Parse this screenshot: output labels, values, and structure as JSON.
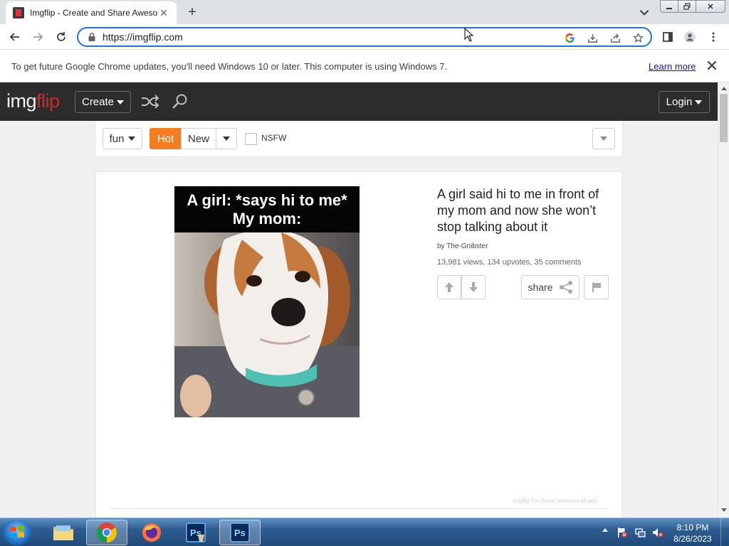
{
  "browser": {
    "tab_title": "Imgflip - Create and Share Awesome Images",
    "tab_close": "✕",
    "new_tab": "+",
    "url": "https://imgflip.com"
  },
  "infobar": {
    "message": "To get future Google Chrome updates, you'll need Windows 10 or later. This computer is using Windows 7.",
    "link": "Learn more"
  },
  "site": {
    "logo_part1": "img",
    "logo_part2": "flip",
    "create_label": "Create",
    "login_label": "Login",
    "logo_red": "#cc2a2a",
    "header_bg": "#2c2c2c"
  },
  "filters": {
    "category": "fun",
    "hot_label": "Hot",
    "new_label": "New",
    "nsfw_label": "NSFW",
    "hot_color": "#f57c1f"
  },
  "post": {
    "meme_caption_line1": "A girl: *says hi to me*",
    "meme_caption_line2": "My mom:",
    "title": "A girl said hi to me in front of my mom and now she won’t stop talking about it",
    "by_prefix": "by ",
    "author": "The-Gnibster",
    "stats": "13,981 views, 134 upvotes, 35 comments",
    "share_label": "share",
    "pro_note": "Imgflip Pro Basic removes all ads"
  },
  "taskbar": {
    "time": "8:10 PM",
    "date": "8/26/2023"
  },
  "icons": {
    "shuffle": "shuffle-icon",
    "search": "search-icon",
    "upvote": "arrow-up-icon",
    "downvote": "arrow-down-icon",
    "share": "share-icon",
    "flag": "flag-icon"
  }
}
